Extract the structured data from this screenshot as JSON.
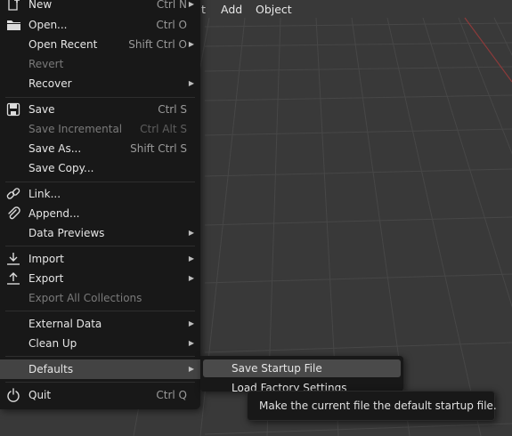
{
  "menubar": {
    "items": [
      {
        "label": "t"
      },
      {
        "label": "Add"
      },
      {
        "label": "Object"
      }
    ]
  },
  "file_menu": {
    "items": [
      {
        "label": "New",
        "shortcut": "Ctrl N",
        "icon": "new-file-icon",
        "submenu": true
      },
      {
        "label": "Open...",
        "shortcut": "Ctrl O",
        "icon": "folder-icon"
      },
      {
        "label": "Open Recent",
        "shortcut": "Shift Ctrl O",
        "submenu": true
      },
      {
        "label": "Revert",
        "disabled": true
      },
      {
        "label": "Recover",
        "submenu": true
      },
      {
        "label": "Save",
        "shortcut": "Ctrl S",
        "icon": "save-icon"
      },
      {
        "label": "Save Incremental",
        "shortcut": "Ctrl Alt S",
        "disabled": true
      },
      {
        "label": "Save As...",
        "shortcut": "Shift Ctrl S"
      },
      {
        "label": "Save Copy..."
      },
      {
        "label": "Link...",
        "icon": "link-icon"
      },
      {
        "label": "Append...",
        "icon": "paperclip-icon"
      },
      {
        "label": "Data Previews",
        "submenu": true
      },
      {
        "label": "Import",
        "icon": "import-icon",
        "submenu": true
      },
      {
        "label": "Export",
        "icon": "export-icon",
        "submenu": true
      },
      {
        "label": "Export All Collections",
        "disabled": true
      },
      {
        "label": "External Data",
        "submenu": true
      },
      {
        "label": "Clean Up",
        "submenu": true
      },
      {
        "label": "Defaults",
        "submenu": true,
        "active": true
      },
      {
        "label": "Quit",
        "shortcut": "Ctrl Q",
        "icon": "power-icon"
      }
    ]
  },
  "defaults_submenu": {
    "items": [
      {
        "label": "Save Startup File",
        "highlighted": true
      },
      {
        "label": "Load Factory Settings"
      }
    ]
  },
  "tooltip": {
    "text": "Make the current file the default startup file."
  },
  "colors": {
    "menu_bg": "#181818",
    "active_item": "#434343",
    "highlight_item": "#4a4a4a",
    "viewport_bg": "#3a3a3a",
    "grid_line": "#4a4a4a",
    "x_axis": "#8b3a3a",
    "disabled_text": "#7a7a7a",
    "shortcut_text": "#9a9a9a"
  }
}
